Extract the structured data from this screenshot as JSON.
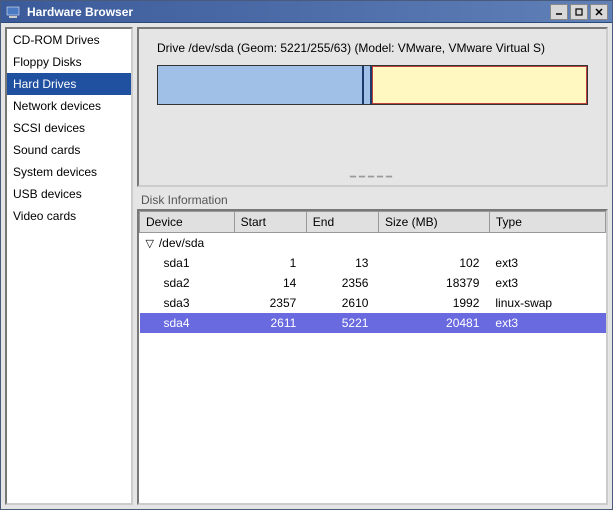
{
  "window": {
    "title": "Hardware Browser"
  },
  "sidebar": {
    "items": [
      {
        "label": "CD-ROM Drives",
        "selected": false
      },
      {
        "label": "Floppy Disks",
        "selected": false
      },
      {
        "label": "Hard Drives",
        "selected": true
      },
      {
        "label": "Network devices",
        "selected": false
      },
      {
        "label": "SCSI devices",
        "selected": false
      },
      {
        "label": "Sound cards",
        "selected": false
      },
      {
        "label": "System devices",
        "selected": false
      },
      {
        "label": "USB devices",
        "selected": false
      },
      {
        "label": "Video cards",
        "selected": false
      }
    ]
  },
  "drive": {
    "summary": "Drive /dev/sda (Geom: 5221/255/63) (Model: VMware, VMware Virtual S)"
  },
  "partitions_bar": {
    "segments": [
      {
        "name": "sda1-sda3",
        "fraction": 0.49,
        "color": "#a0c0e8"
      },
      {
        "name": "divider",
        "fraction": 0.01,
        "color": "#a0c0e8"
      },
      {
        "name": "sda4",
        "fraction": 0.5,
        "color": "#fff8c0"
      }
    ]
  },
  "disk_info": {
    "label": "Disk Information",
    "columns": [
      "Device",
      "Start",
      "End",
      "Size (MB)",
      "Type"
    ],
    "parent": "/dev/sda",
    "rows": [
      {
        "device": "sda1",
        "start": "1",
        "end": "13",
        "size": "102",
        "type": "ext3",
        "selected": false
      },
      {
        "device": "sda2",
        "start": "14",
        "end": "2356",
        "size": "18379",
        "type": "ext3",
        "selected": false
      },
      {
        "device": "sda3",
        "start": "2357",
        "end": "2610",
        "size": "1992",
        "type": "linux-swap",
        "selected": false
      },
      {
        "device": "sda4",
        "start": "2611",
        "end": "5221",
        "size": "20481",
        "type": "ext3",
        "selected": true
      }
    ]
  }
}
